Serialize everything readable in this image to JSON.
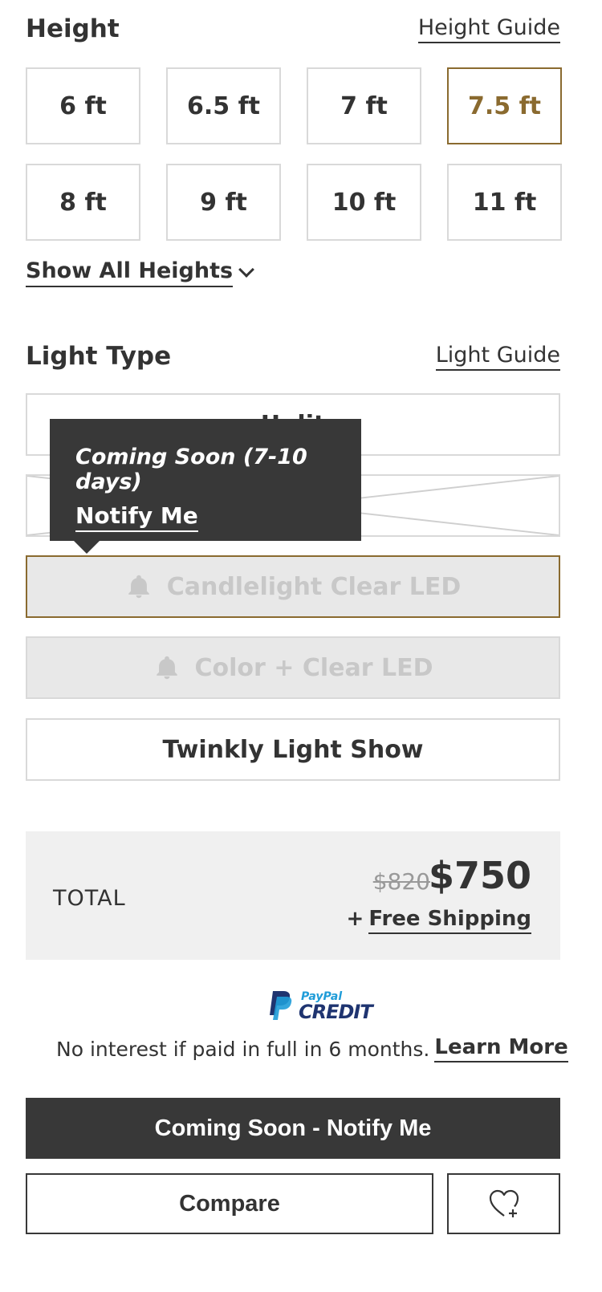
{
  "height": {
    "title": "Height",
    "guide_label": "Height Guide",
    "options": [
      {
        "label": "6 ft",
        "selected": false
      },
      {
        "label": "6.5 ft",
        "selected": false
      },
      {
        "label": "7 ft",
        "selected": false
      },
      {
        "label": "7.5 ft",
        "selected": true
      },
      {
        "label": "8 ft",
        "selected": false
      },
      {
        "label": "9 ft",
        "selected": false
      },
      {
        "label": "10 ft",
        "selected": false
      },
      {
        "label": "11 ft",
        "selected": false
      }
    ],
    "show_all_label": "Show All Heights"
  },
  "light_type": {
    "title": "Light Type",
    "guide_label": "Light Guide",
    "options": [
      {
        "label": "Unlit",
        "state": "available"
      },
      {
        "label": "",
        "state": "unavailable"
      },
      {
        "label": "Candlelight Clear LED",
        "state": "coming-soon"
      },
      {
        "label": "Color + Clear LED",
        "state": "coming-soon"
      },
      {
        "label": "Twinkly Light Show",
        "state": "available"
      }
    ]
  },
  "tooltip": {
    "text": "Coming Soon (7-10 days)",
    "link": "Notify Me"
  },
  "total": {
    "label": "TOTAL",
    "old_price": "$820",
    "price": "$750",
    "shipping_prefix": "+",
    "shipping_link": "Free Shipping"
  },
  "paypal": {
    "small": "PayPal",
    "big": "CREDIT"
  },
  "credit": {
    "text": "No interest if paid in full in 6 months.",
    "link": "Learn More"
  },
  "actions": {
    "notify_label": "Coming Soon - Notify Me",
    "compare_label": "Compare"
  },
  "colors": {
    "accent_gold": "#8a6a2f",
    "dark": "#383838",
    "border": "#d9d9d9",
    "disabled_bg": "#e8e8e8",
    "paypal_navy": "#1f3470",
    "paypal_blue": "#1f9cd8"
  },
  "icons": {
    "chevron": "chevron-down-icon",
    "bell": "bell-icon",
    "heart": "heart-plus-icon",
    "paypal": "paypal-logo-icon"
  }
}
